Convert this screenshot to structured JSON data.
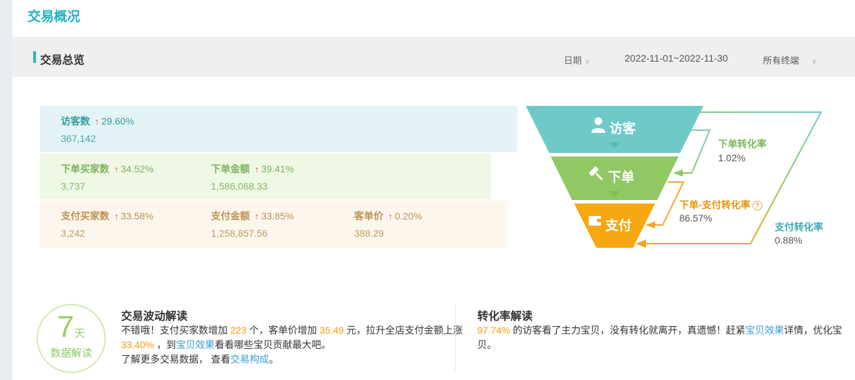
{
  "page": {
    "title": "交易概况"
  },
  "icons": {
    "up_arrow": "↑",
    "chevron_down": "∨",
    "help": "?"
  },
  "section": {
    "title": "交易总览",
    "date_label": "日期",
    "date_range": "2022-11-01~2022-11-30",
    "terminal_selected": "所有终端"
  },
  "metrics": {
    "rows": [
      {
        "cells": [
          {
            "label": "访客数",
            "pct": "29.60%",
            "value": "367,142"
          }
        ]
      },
      {
        "cells": [
          {
            "label": "下单买家数",
            "pct": "34.52%",
            "value": "3,737"
          },
          {
            "label": "下单金额",
            "pct": "39.41%",
            "value": "1,586,068.33"
          }
        ]
      },
      {
        "cells": [
          {
            "label": "支付买家数",
            "pct": "33.58%",
            "value": "3,242"
          },
          {
            "label": "支付金额",
            "pct": "33.85%",
            "value": "1,258,857.56"
          },
          {
            "label": "客单价",
            "pct": "0.20%",
            "value": "388.29"
          }
        ]
      }
    ]
  },
  "funnel": {
    "stages": [
      {
        "label": "访客",
        "color": "#6fc9c9"
      },
      {
        "label": "下单",
        "color": "#90c863"
      },
      {
        "label": "支付",
        "color": "#f7a712"
      }
    ],
    "conversions": [
      {
        "label": "下单转化率",
        "value": "1.02%"
      },
      {
        "label": "下单-支付转化率",
        "value": "86.57%"
      },
      {
        "label": "支付转化率",
        "value": "0.88%"
      }
    ]
  },
  "insights": {
    "badge": {
      "big": "7",
      "unit": "天",
      "sub": "数据解读"
    },
    "left": {
      "title": "交易波动解读",
      "lines": [
        [
          {
            "t": "不错哦！支付买家数增加 "
          },
          {
            "t": "223",
            "c": "num"
          },
          {
            "t": " 个，客单价增加 "
          },
          {
            "t": "35.49",
            "c": "num"
          },
          {
            "t": " 元，拉升全店支付金额上涨"
          }
        ],
        [
          {
            "t": " "
          },
          {
            "t": "33.40%",
            "c": "num"
          },
          {
            "t": " ，到"
          },
          {
            "t": "宝贝效果",
            "c": "link",
            "n": "baobei-effect-link"
          },
          {
            "t": "看看哪些宝贝贡献最大吧。"
          }
        ],
        [
          {
            "t": "了解更多交易数据， 查看"
          },
          {
            "t": "交易构成",
            "c": "link",
            "n": "trade-composition-link"
          },
          {
            "t": "。"
          }
        ]
      ]
    },
    "right": {
      "title": "转化率解读",
      "lines": [
        [
          {
            "t": " "
          },
          {
            "t": "97.74%",
            "c": "num"
          },
          {
            "t": " 的访客看了主力宝贝，没有转化就离开，真遗憾！赶紧"
          },
          {
            "t": "宝贝效果",
            "c": "link",
            "n": "baobei-effect-link"
          },
          {
            "t": "详情，优化宝"
          }
        ],
        [
          {
            "t": "贝。"
          }
        ]
      ]
    }
  }
}
